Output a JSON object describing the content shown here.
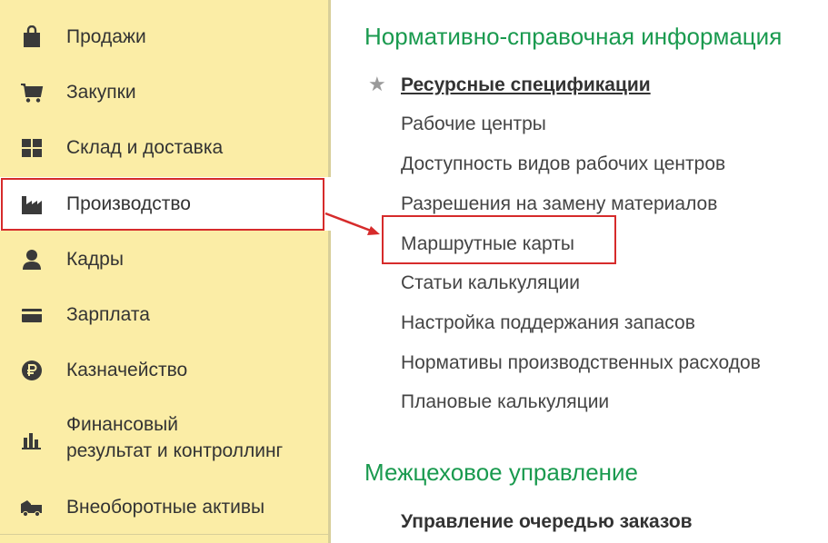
{
  "sidebar": {
    "items": [
      {
        "label": "Продажи",
        "icon": "shopping-bag-icon"
      },
      {
        "label": "Закупки",
        "icon": "cart-icon"
      },
      {
        "label": "Склад и доставка",
        "icon": "warehouse-icon"
      },
      {
        "label": "Производство",
        "icon": "factory-icon",
        "active": true
      },
      {
        "label": "Кадры",
        "icon": "person-icon"
      },
      {
        "label": "Зарплата",
        "icon": "card-icon"
      },
      {
        "label": "Казначейство",
        "icon": "ruble-icon"
      },
      {
        "label_line1": "Финансовый",
        "label_line2": "результат и контроллинг",
        "icon": "bar-chart-icon"
      },
      {
        "label": "Внеоборотные активы",
        "icon": "truck-icon"
      }
    ]
  },
  "main": {
    "section1": {
      "title": "Нормативно-справочная информация",
      "star": "★",
      "links": [
        "Ресурсные спецификации",
        "Рабочие центры",
        "Доступность видов рабочих центров",
        "Разрешения на замену материалов",
        "Маршрутные карты",
        "Статьи калькуляции",
        "Настройка поддержания запасов",
        "Нормативы производственных расходов",
        "Плановые калькуляции"
      ]
    },
    "section2": {
      "title": "Межцеховое управление",
      "links": [
        "Управление очередью заказов"
      ]
    }
  },
  "colors": {
    "sidebar_bg": "#fbeda6",
    "section_title": "#1a9a4f",
    "highlight_border": "#d62b2b"
  }
}
